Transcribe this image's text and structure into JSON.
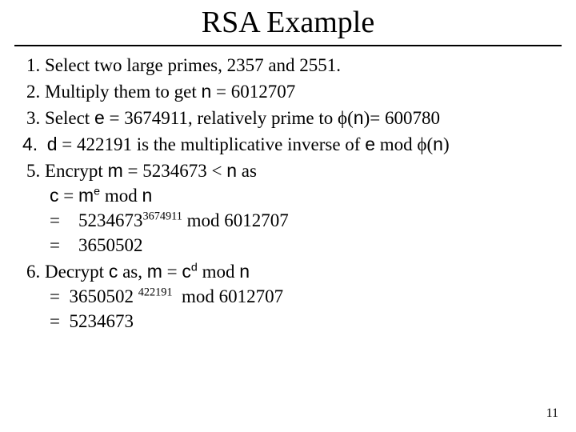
{
  "title": "RSA Example",
  "steps": {
    "s1": "Select two large primes, 2357 and 2551.",
    "s2a": "Multiply them to get ",
    "s2_n": "n",
    "s2b": " = 6012707",
    "s3a": "Select ",
    "s3_e": "e",
    "s3b": " = 3674911, relatively prime to ϕ(",
    "s3_n": "n",
    "s3c": ")= 600780",
    "s4_num": "4.",
    "s4_d": "d",
    "s4a": " = 422191 is the multiplicative inverse of ",
    "s4_e": "e",
    "s4b": " mod ϕ(",
    "s4_n": "n",
    "s4c": ")",
    "s5a": "Encrypt ",
    "s5_m": "m",
    "s5b": " = 5234673 < ",
    "s5_n": "n",
    "s5c": " as",
    "s5_line1_c": "c",
    "s5_line1_eq": " = ",
    "s5_line1_m": "m",
    "s5_line1_e": "e",
    "s5_line1_mod": " mod ",
    "s5_line1_n": "n",
    "s5_line2_eq": "=    5234673",
    "s5_line2_exp": "3674911",
    "s5_line2_mod": " mod 6012707",
    "s5_line3": "=    3650502",
    "s6a": "Decrypt ",
    "s6_c": "c",
    "s6b": " as, ",
    "s6_m": "m",
    "s6c": " = ",
    "s6_cc": "c",
    "s6_d": "d",
    "s6d": " mod ",
    "s6_n": "n",
    "s6_line1a": "=  3650502 ",
    "s6_line1_exp": "422191",
    "s6_line1b": "  mod 6012707",
    "s6_line2": "=  5234673"
  },
  "page_number": "11"
}
